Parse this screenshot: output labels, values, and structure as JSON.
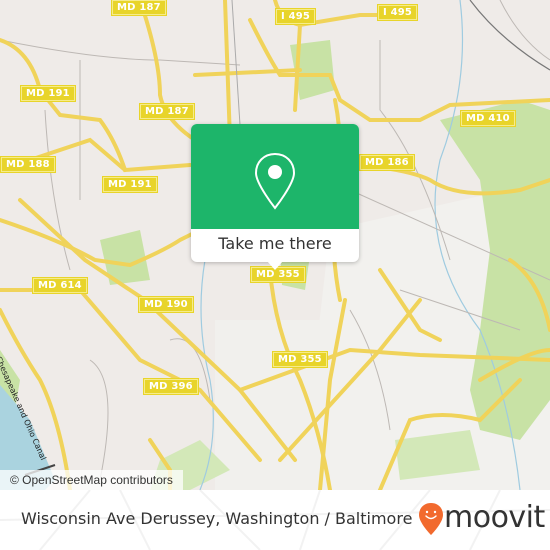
{
  "map": {
    "attribution": "© OpenStreetMap contributors",
    "road_labels": [
      {
        "id": "md187-top",
        "text": "MD 187"
      },
      {
        "id": "i495-left",
        "text": "I 495"
      },
      {
        "id": "i495-right",
        "text": "I 495"
      },
      {
        "id": "md191-a",
        "text": "MD 191"
      },
      {
        "id": "md187-b",
        "text": "MD 187"
      },
      {
        "id": "md410",
        "text": "MD 410"
      },
      {
        "id": "md188",
        "text": "MD 188"
      },
      {
        "id": "md186",
        "text": "MD 186"
      },
      {
        "id": "md191-b",
        "text": "MD 191"
      },
      {
        "id": "md355-a",
        "text": "MD 355"
      },
      {
        "id": "md614",
        "text": "MD 614"
      },
      {
        "id": "md190",
        "text": "MD 190"
      },
      {
        "id": "md355-b",
        "text": "MD 355"
      },
      {
        "id": "md396",
        "text": "MD 396"
      }
    ],
    "water_label": "Chesapeake and Ohio Canal",
    "colors": {
      "land": "#efebe8",
      "park": "#c8e2a5",
      "water": "#aad3df",
      "road": "#f7e27a",
      "label_bg": "#e8d42a"
    }
  },
  "popup": {
    "button_label": "Take me there",
    "icon": "map-pin-icon",
    "color": "#1db56a"
  },
  "footer": {
    "place_name": "Wisconsin Ave Derussey, Washington / Baltimore",
    "brand": "moovit",
    "brand_color": "#f26a2e"
  }
}
